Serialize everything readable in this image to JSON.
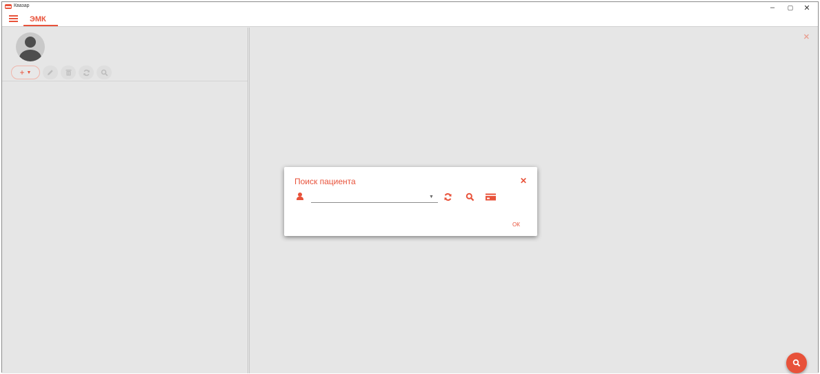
{
  "window": {
    "title": "Квазар",
    "controls": [
      "–",
      "▢",
      "✕"
    ]
  },
  "header": {
    "tab_label": "ЭМК"
  },
  "left_panel": {
    "toolbar": {
      "add_icon": "plus-icon",
      "add_caret_icon": "caret-down-icon",
      "buttons": [
        "pencil-icon",
        "trash-icon",
        "refresh-icon",
        "search-icon"
      ]
    }
  },
  "right_panel": {
    "close_icon": "close-icon",
    "fab_icon": "search-icon"
  },
  "dialog": {
    "title": "Поиск пациента",
    "patient_field_value": "",
    "ok_label": "ОК",
    "icons": [
      "person-icon",
      "refresh-icon",
      "search-icon",
      "card-icon"
    ]
  },
  "colors": {
    "accent": "#e8523a",
    "panel_bg": "#e6e6e6",
    "dialog_bg": "#ffffff"
  }
}
